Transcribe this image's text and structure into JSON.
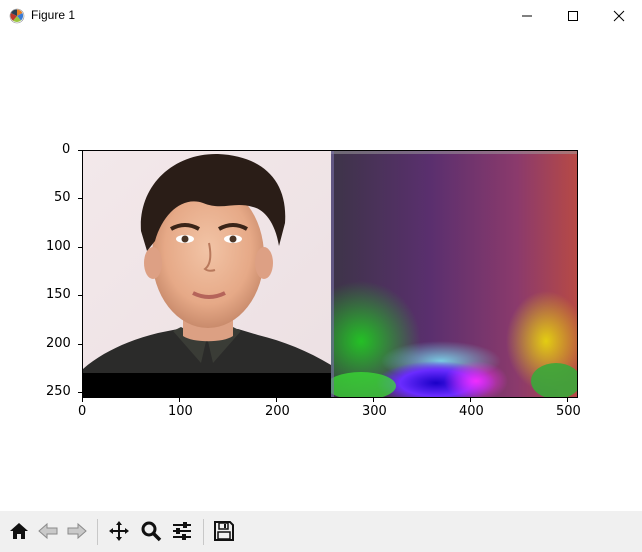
{
  "window": {
    "title": "Figure 1",
    "minimize_icon": "minimize-icon",
    "maximize_icon": "maximize-icon",
    "close_icon": "close-icon"
  },
  "figure": {
    "y_ticks": [
      "0",
      "50",
      "100",
      "150",
      "200",
      "250"
    ],
    "x_ticks": [
      "0",
      "100",
      "200",
      "300",
      "400",
      "500"
    ],
    "left_image": "portrait-photo",
    "right_image": "color-map-visualization"
  },
  "toolbar": {
    "buttons": [
      {
        "icon": "home-icon",
        "name": "home"
      },
      {
        "icon": "back-arrow-icon",
        "name": "back"
      },
      {
        "icon": "forward-arrow-icon",
        "name": "forward"
      },
      {
        "icon": "pan-icon",
        "name": "pan"
      },
      {
        "icon": "zoom-icon",
        "name": "zoom"
      },
      {
        "icon": "subplots-icon",
        "name": "configure-subplots"
      },
      {
        "icon": "save-icon",
        "name": "save"
      }
    ]
  }
}
